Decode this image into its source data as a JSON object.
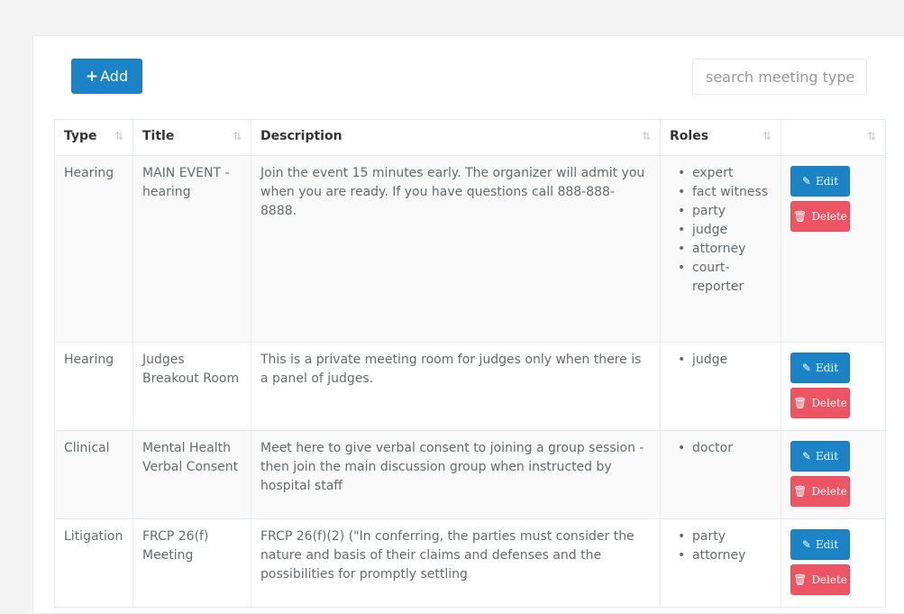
{
  "toolbar": {
    "add_label": "Add",
    "search_placeholder": "search meeting type"
  },
  "table": {
    "headers": [
      "Type",
      "Title",
      "Description",
      "Roles",
      ""
    ],
    "rows": [
      {
        "type": "Hearing",
        "title": "MAIN EVENT - hearing",
        "description": "Join the event 15 minutes early. The organizer will admit you when you are ready. If you have questions call 888-888-8888.",
        "roles": [
          "expert",
          "fact witness",
          "party",
          "judge",
          "attorney",
          "court-reporter"
        ]
      },
      {
        "type": "Hearing",
        "title": "Judges Breakout Room",
        "description": "This is a private meeting room for judges only when there is a panel of judges.",
        "roles": [
          "judge"
        ]
      },
      {
        "type": "Clinical",
        "title": "Mental Health Verbal Consent",
        "description": "Meet here to give verbal consent to joining a group session - then join the main discussion group when instructed by hospital staff",
        "roles": [
          "doctor"
        ]
      },
      {
        "type": "Litigation",
        "title": "FRCP 26(f) Meeting",
        "description": "FRCP 26(f)(2) (\"In conferring, the parties must consider the nature and basis of their claims and defenses and the possibilities for promptly settling",
        "roles": [
          "party",
          "attorney"
        ]
      }
    ],
    "edit_label": "Edit",
    "delete_label": "Delete"
  }
}
